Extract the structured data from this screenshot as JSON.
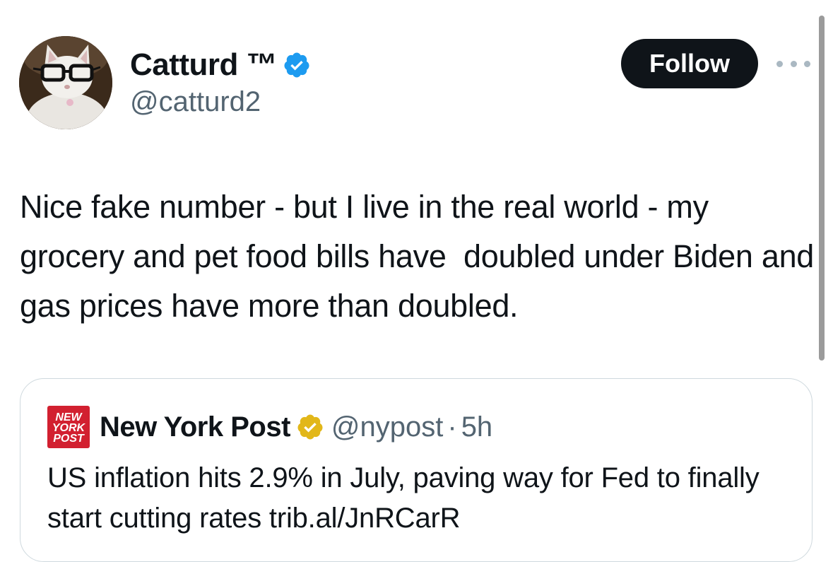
{
  "author": {
    "display_name": "Catturd ™",
    "handle": "@catturd2",
    "verified": true,
    "verified_badge_color": "#1d9bf0",
    "avatar_icon": "cat-with-glasses-avatar"
  },
  "actions": {
    "follow_label": "Follow",
    "more_icon": "more-dots-icon"
  },
  "tweet": {
    "text": "Nice fake number - but I live in the real world - my grocery and pet food bills have  doubled under Biden and gas prices have more than doubled."
  },
  "quoted_tweet": {
    "logo_lines": [
      "NEW",
      "YORK",
      "POST"
    ],
    "logo_color": "#d22030",
    "display_name": "New York Post",
    "verified_badge_color": "#e2b719",
    "handle": "@nypost",
    "separator": "·",
    "time": "5h",
    "text": "US inflation hits 2.9% in July, paving way for Fed to finally start cutting rates trib.al/JnRCarR"
  },
  "colors": {
    "text_primary": "#0f1419",
    "text_secondary": "#536471",
    "follow_button_bg": "#0f1419",
    "card_border": "#cfd9de"
  }
}
